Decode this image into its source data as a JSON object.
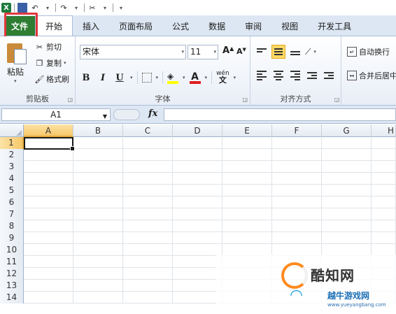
{
  "quick_access": {
    "app_icon": "X"
  },
  "tabs": [
    {
      "label": "文件",
      "active": false
    },
    {
      "label": "开始",
      "active": true
    },
    {
      "label": "插入",
      "active": false
    },
    {
      "label": "页面布局",
      "active": false
    },
    {
      "label": "公式",
      "active": false
    },
    {
      "label": "数据",
      "active": false
    },
    {
      "label": "审阅",
      "active": false
    },
    {
      "label": "视图",
      "active": false
    },
    {
      "label": "开发工具",
      "active": false
    }
  ],
  "ribbon": {
    "clipboard": {
      "label": "剪贴板",
      "paste": "粘贴",
      "cut": "剪切",
      "copy": "复制",
      "format_painter": "格式刷"
    },
    "font": {
      "label": "字体",
      "font_name": "宋体",
      "font_size": "11",
      "grow": "A",
      "shrink": "A",
      "bold": "B",
      "italic": "I",
      "underline": "U",
      "font_color_glyph": "A",
      "phonetic": "wén"
    },
    "alignment": {
      "label": "对齐方式",
      "wrap_text": "自动换行",
      "merge_center": "合并后居中"
    }
  },
  "formula_bar": {
    "name_box": "A1",
    "fx": "fx",
    "value": ""
  },
  "grid": {
    "columns": [
      "A",
      "B",
      "C",
      "D",
      "E",
      "F",
      "G",
      "H"
    ],
    "rows": [
      "1",
      "2",
      "3",
      "4",
      "5",
      "6",
      "7",
      "8",
      "9",
      "10",
      "11",
      "12",
      "13",
      "14"
    ],
    "selected_column": "A",
    "selected_row": "1"
  },
  "watermark": {
    "brand": "酷知网",
    "sub": "越牛游戏网",
    "url": "www.yueyangbang.com"
  },
  "colors": {
    "file_tab": "#2e7d32",
    "highlight": "#e0393c",
    "selection": "#f6c86a"
  }
}
